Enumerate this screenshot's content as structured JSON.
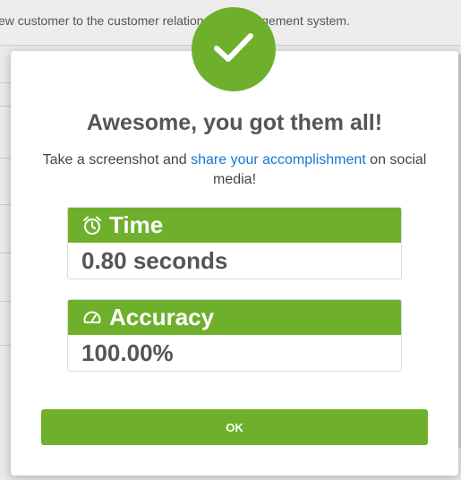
{
  "background": {
    "header_text": "ew customer to the customer relationship management system."
  },
  "modal": {
    "title": "Awesome, you got them all!",
    "subtitle_before": "Take a screenshot and ",
    "subtitle_link": "share your accomplishment",
    "subtitle_after": " on social media!",
    "success_icon": "checkmark-icon",
    "accent_color": "#6eb02b",
    "link_color": "#1477d3"
  },
  "stats": {
    "time": {
      "icon": "alarm-clock-icon",
      "label": "Time",
      "value": "0.80 seconds"
    },
    "accuracy": {
      "icon": "speedometer-icon",
      "label": "Accuracy",
      "value": "100.00%"
    }
  },
  "actions": {
    "ok_label": "OK"
  }
}
